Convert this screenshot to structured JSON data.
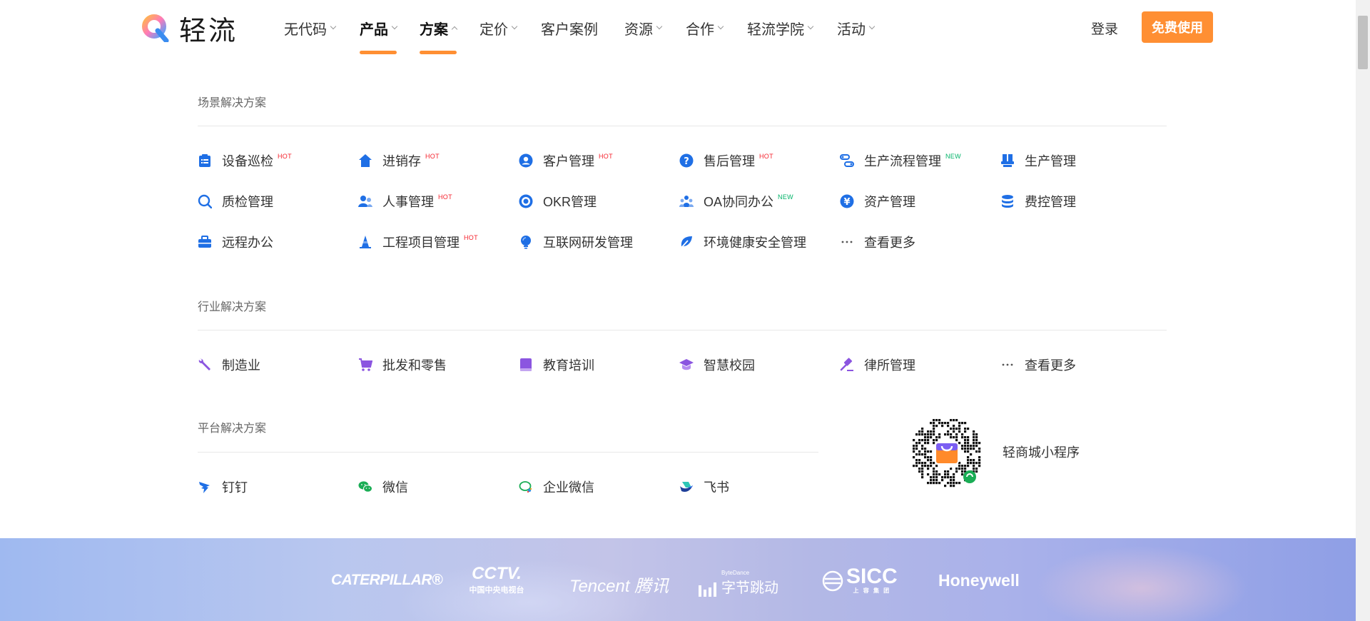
{
  "header": {
    "logo_text": "轻流",
    "nav": [
      {
        "label": "无代码",
        "chevron": "down"
      },
      {
        "label": "产品",
        "chevron": "down",
        "bold": true,
        "underline": true
      },
      {
        "label": "方案",
        "chevron": "up",
        "bold": true,
        "underline": true
      },
      {
        "label": "定价",
        "chevron": "down"
      },
      {
        "label": "客户案例",
        "chevron": ""
      },
      {
        "label": "资源",
        "chevron": "down"
      },
      {
        "label": "合作",
        "chevron": "down"
      },
      {
        "label": "轻流学院",
        "chevron": "down"
      },
      {
        "label": "活动",
        "chevron": "down"
      }
    ],
    "login": "登录",
    "cta": "免费使用"
  },
  "menu": {
    "scenario_title": "场景解决方案",
    "scenario_items": [
      {
        "label": "设备巡检",
        "icon": "clipboard-icon",
        "badge": "HOT"
      },
      {
        "label": "进销存",
        "icon": "home-icon",
        "badge": "HOT"
      },
      {
        "label": "客户管理",
        "icon": "user-circle-icon",
        "badge": "HOT"
      },
      {
        "label": "售后管理",
        "icon": "question-icon",
        "badge": "HOT"
      },
      {
        "label": "生产流程管理",
        "icon": "flow-icon",
        "badge": "NEW"
      },
      {
        "label": "生产管理",
        "icon": "stamp-icon",
        "badge": ""
      },
      {
        "label": "质检管理",
        "icon": "magnifier-icon",
        "badge": ""
      },
      {
        "label": "人事管理",
        "icon": "people-icon",
        "badge": "HOT"
      },
      {
        "label": "OKR管理",
        "icon": "target-icon",
        "badge": ""
      },
      {
        "label": "OA协同办公",
        "icon": "team-icon",
        "badge": "NEW"
      },
      {
        "label": "资产管理",
        "icon": "yen-icon",
        "badge": ""
      },
      {
        "label": "费控管理",
        "icon": "database-icon",
        "badge": ""
      },
      {
        "label": "远程办公",
        "icon": "briefcase-icon",
        "badge": ""
      },
      {
        "label": "工程项目管理",
        "icon": "cone-icon",
        "badge": "HOT"
      },
      {
        "label": "互联网研发管理",
        "icon": "bulb-icon",
        "badge": ""
      },
      {
        "label": "环境健康安全管理",
        "icon": "leaf-icon",
        "badge": ""
      },
      {
        "label": "查看更多",
        "icon": "more-icon",
        "badge": ""
      }
    ],
    "industry_title": "行业解决方案",
    "industry_items": [
      {
        "label": "制造业",
        "icon": "wrench-icon"
      },
      {
        "label": "批发和零售",
        "icon": "cart-icon"
      },
      {
        "label": "教育培训",
        "icon": "book-icon"
      },
      {
        "label": "智慧校园",
        "icon": "mortarboard-icon"
      },
      {
        "label": "律所管理",
        "icon": "gavel-icon"
      },
      {
        "label": "查看更多",
        "icon": "more-icon"
      }
    ],
    "platform_title": "平台解决方案",
    "platform_items": [
      {
        "label": "钉钉",
        "icon": "dingtalk-icon"
      },
      {
        "label": "微信",
        "icon": "wechat-icon"
      },
      {
        "label": "企业微信",
        "icon": "wecom-icon"
      },
      {
        "label": "飞书",
        "icon": "feishu-icon"
      }
    ],
    "qr_label": "轻商城小程序"
  },
  "banner": {
    "brands": [
      {
        "name": "CATERPILLAR®"
      },
      {
        "name": "CCTV.",
        "sub": "中国中央电视台"
      },
      {
        "name": "Tencent 腾讯"
      },
      {
        "name": "字节跳动",
        "sup": "ByteDance"
      },
      {
        "name": "SICC",
        "sub": "上 容 集 团"
      },
      {
        "name": "Honeywell"
      }
    ]
  },
  "colors": {
    "accent": "#ff8f33",
    "icon_blue": "#1f6fe5",
    "icon_purple": "#8b55e0",
    "hot": "#f5222d",
    "new": "#00b368"
  }
}
